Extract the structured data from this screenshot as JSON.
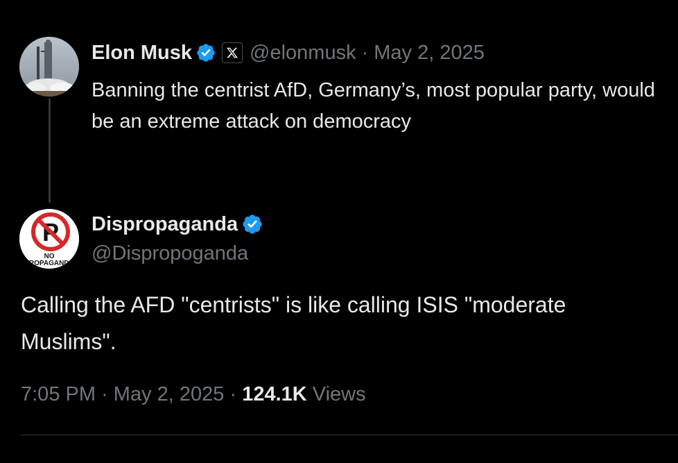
{
  "quoted_post": {
    "author_name": "Elon Musk",
    "author_handle": "@elonmusk",
    "separator": "·",
    "date": "May 2, 2025",
    "text": "Banning the centrist AfD, Germany’s, most popular party, would be an extreme attack on democracy"
  },
  "reply_post": {
    "author_name": "Dispropaganda",
    "author_handle": "@Dispropoganda",
    "avatar_caption_top": "NO",
    "avatar_caption_bottom": "PROPAGANDA",
    "text": "Calling the AFD \"centrists\" is like calling ISIS \"moderate Muslims\".",
    "time": "7:05 PM",
    "separator": "·",
    "date": "May 2, 2025",
    "views_count": "124.1K",
    "views_label": "Views"
  },
  "icons": {
    "verified": "verified-badge-icon",
    "x_logo": "x-logo-icon"
  },
  "colors": {
    "background": "#000000",
    "text": "#e7e9ea",
    "muted": "#71767b",
    "verified": "#1d9bf0",
    "no_sign": "#d62828"
  }
}
